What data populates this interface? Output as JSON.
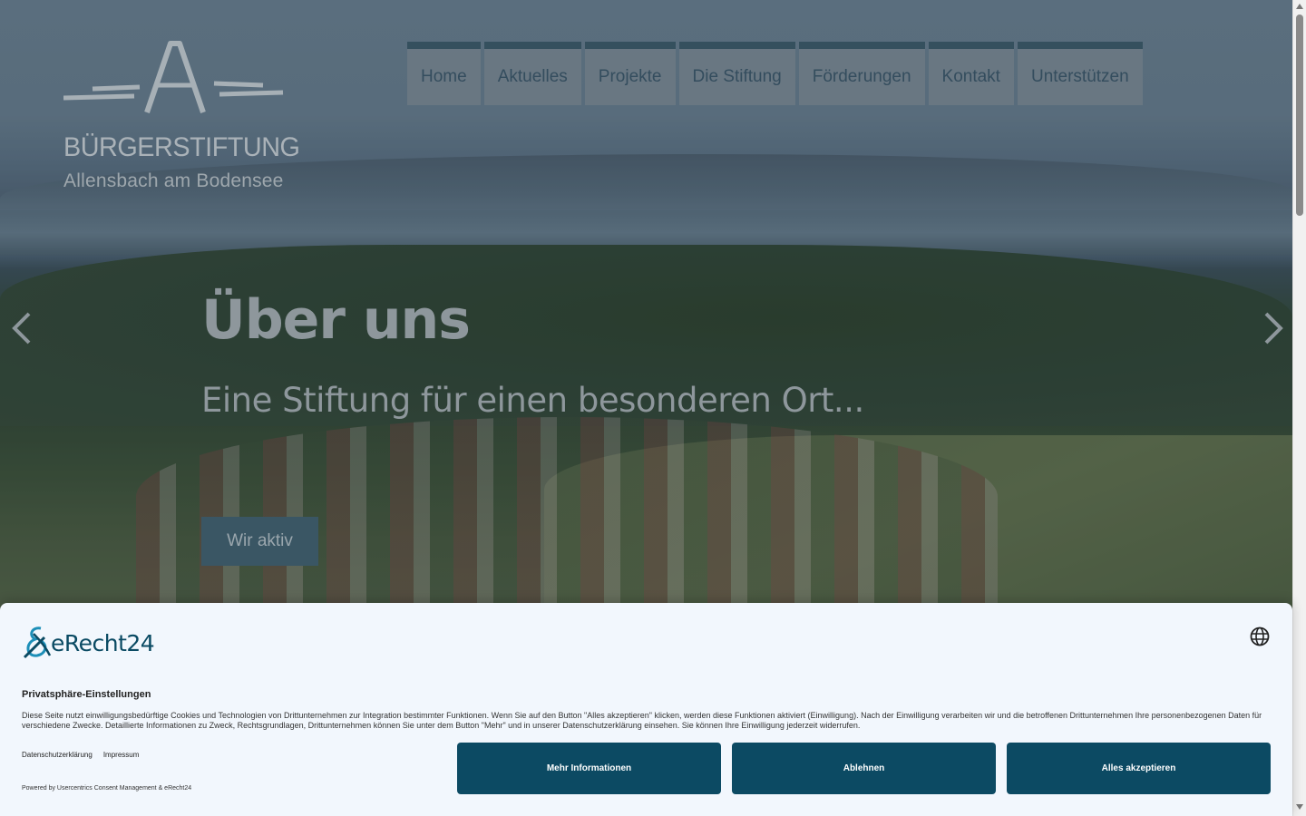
{
  "logo": {
    "name": "BÜRGERSTIFTUNG",
    "subtitle": "Allensbach am Bodensee"
  },
  "nav": {
    "items": [
      "Home",
      "Aktuelles",
      "Projekte",
      "Die Stiftung",
      "Förderungen",
      "Kontakt",
      "Unterstützen"
    ]
  },
  "hero": {
    "title": "Über uns",
    "subtitle": "Eine Stiftung für einen besonderen Ort...",
    "button": "Wir aktiv"
  },
  "consent": {
    "brand": "eRecht24",
    "title": "Privatsphäre-Einstellungen",
    "text": "Diese Seite nutzt einwilligungsbedürftige Cookies und Technologien von Drittunternehmen zur Integration bestimmter Funktionen. Wenn Sie auf den Button \"Alles akzeptieren\" klicken, werden diese Funktionen aktiviert (Einwilligung). Nach der Einwilligung verarbeiten wir und die betroffenen Drittunternehmen Ihre personenbezogenen Daten für verschiedene Zwecke. Detaillierte Informationen zu Zweck, Rechtsgrundlagen, Drittunternehmen können Sie unter dem Button \"Mehr\" und in unserer Datenschutzerklärung einsehen. Sie können Ihre Einwilligung jederzeit widerrufen.",
    "links": [
      "Datenschutzerklärung",
      "Impressum"
    ],
    "powered": "Powered by Usercentrics Consent Management & eRecht24",
    "buttons": {
      "more": "Mehr Informationen",
      "deny": "Ablehnen",
      "accept": "Alles akzeptieren"
    }
  },
  "colors": {
    "brand": "#0c4a63",
    "nav_border": "#35505e",
    "banner_bg": "#f2f7fd"
  },
  "icons": {
    "prev": "chevron-left-icon",
    "next": "chevron-right-icon",
    "language": "globe-icon",
    "brand": "erecht24-logo-icon"
  }
}
